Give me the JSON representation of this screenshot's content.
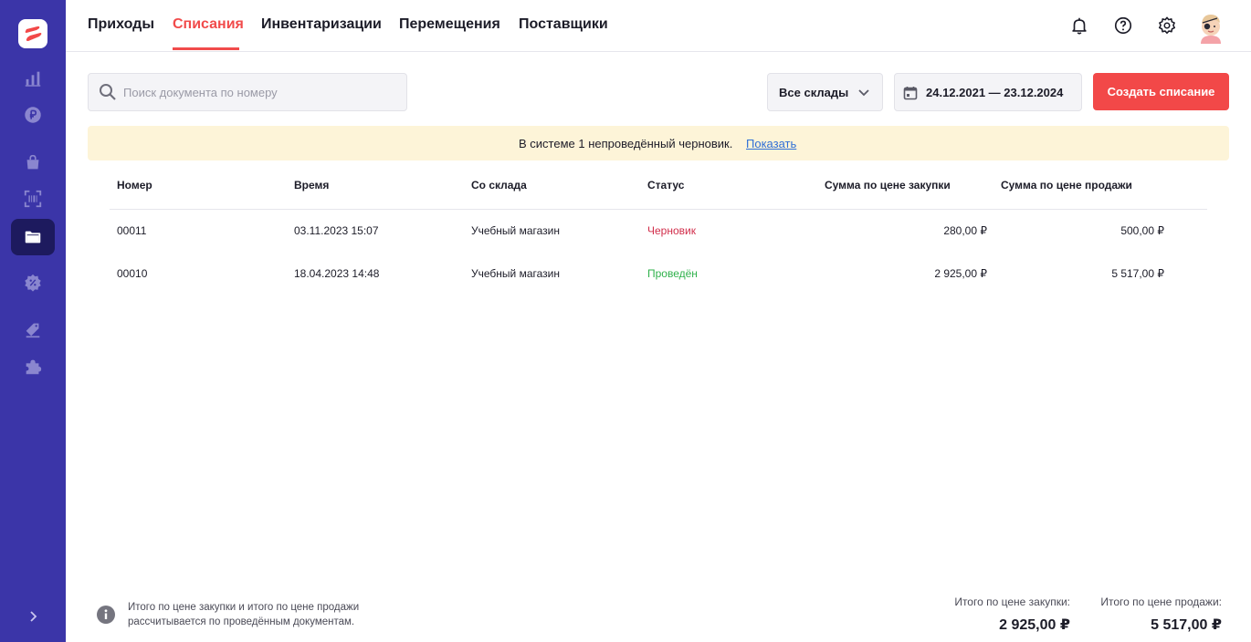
{
  "nav": {
    "tabs": [
      {
        "label": "Приходы",
        "active": false
      },
      {
        "label": "Списания",
        "active": true
      },
      {
        "label": "Инвентаризации",
        "active": false
      },
      {
        "label": "Перемещения",
        "active": false
      },
      {
        "label": "Поставщики",
        "active": false
      }
    ]
  },
  "sidebar": {
    "items": [
      {
        "icon": "bar-chart-icon"
      },
      {
        "icon": "ruble-coin-icon"
      },
      {
        "icon": "shopping-bag-icon"
      },
      {
        "icon": "barcode-scan-icon"
      },
      {
        "icon": "folder-icon",
        "active": true
      },
      {
        "icon": "discount-badge-icon"
      },
      {
        "icon": "tags-icon"
      },
      {
        "icon": "puzzle-icon"
      }
    ],
    "expand_icon": "chevron-right-icon"
  },
  "toolbar": {
    "search_placeholder": "Поиск документа по номеру",
    "warehouse_select": "Все склады",
    "date_range": "24.12.2021 — 23.12.2024",
    "create_label": "Создать списание"
  },
  "notice": {
    "text": "В системе 1 непроведённый черновик.",
    "link": "Показать"
  },
  "table": {
    "columns": [
      "Номер",
      "Время",
      "Со склада",
      "Статус",
      "Сумма по цене закупки",
      "Сумма по цене продажи"
    ],
    "rows": [
      {
        "number": "00011",
        "time": "03.11.2023 15:07",
        "warehouse": "Учебный магазин",
        "status": "Черновик",
        "purchase": "280,00 ₽",
        "sale": "500,00 ₽"
      },
      {
        "number": "00010",
        "time": "18.04.2023 14:48",
        "warehouse": "Учебный магазин",
        "status": "Проведён",
        "purchase": "2 925,00 ₽",
        "sale": "5 517,00 ₽"
      }
    ]
  },
  "footer": {
    "note": "Итого по цене закупки и итого по цене продажи рассчитывается по проведённым документам.",
    "purchase_total_label": "Итого по цене закупки:",
    "purchase_total_value": "2 925,00 ₽",
    "sale_total_label": "Итого по цене продажи:",
    "sale_total_value": "5 517,00 ₽"
  },
  "colors": {
    "sidebar": "#3b35a8",
    "sidebar_active": "#1d1a5e",
    "accent": "#f24848",
    "draft": "#d12d4a",
    "done": "#2fb14b",
    "notice_bg": "#fdf4d8"
  }
}
